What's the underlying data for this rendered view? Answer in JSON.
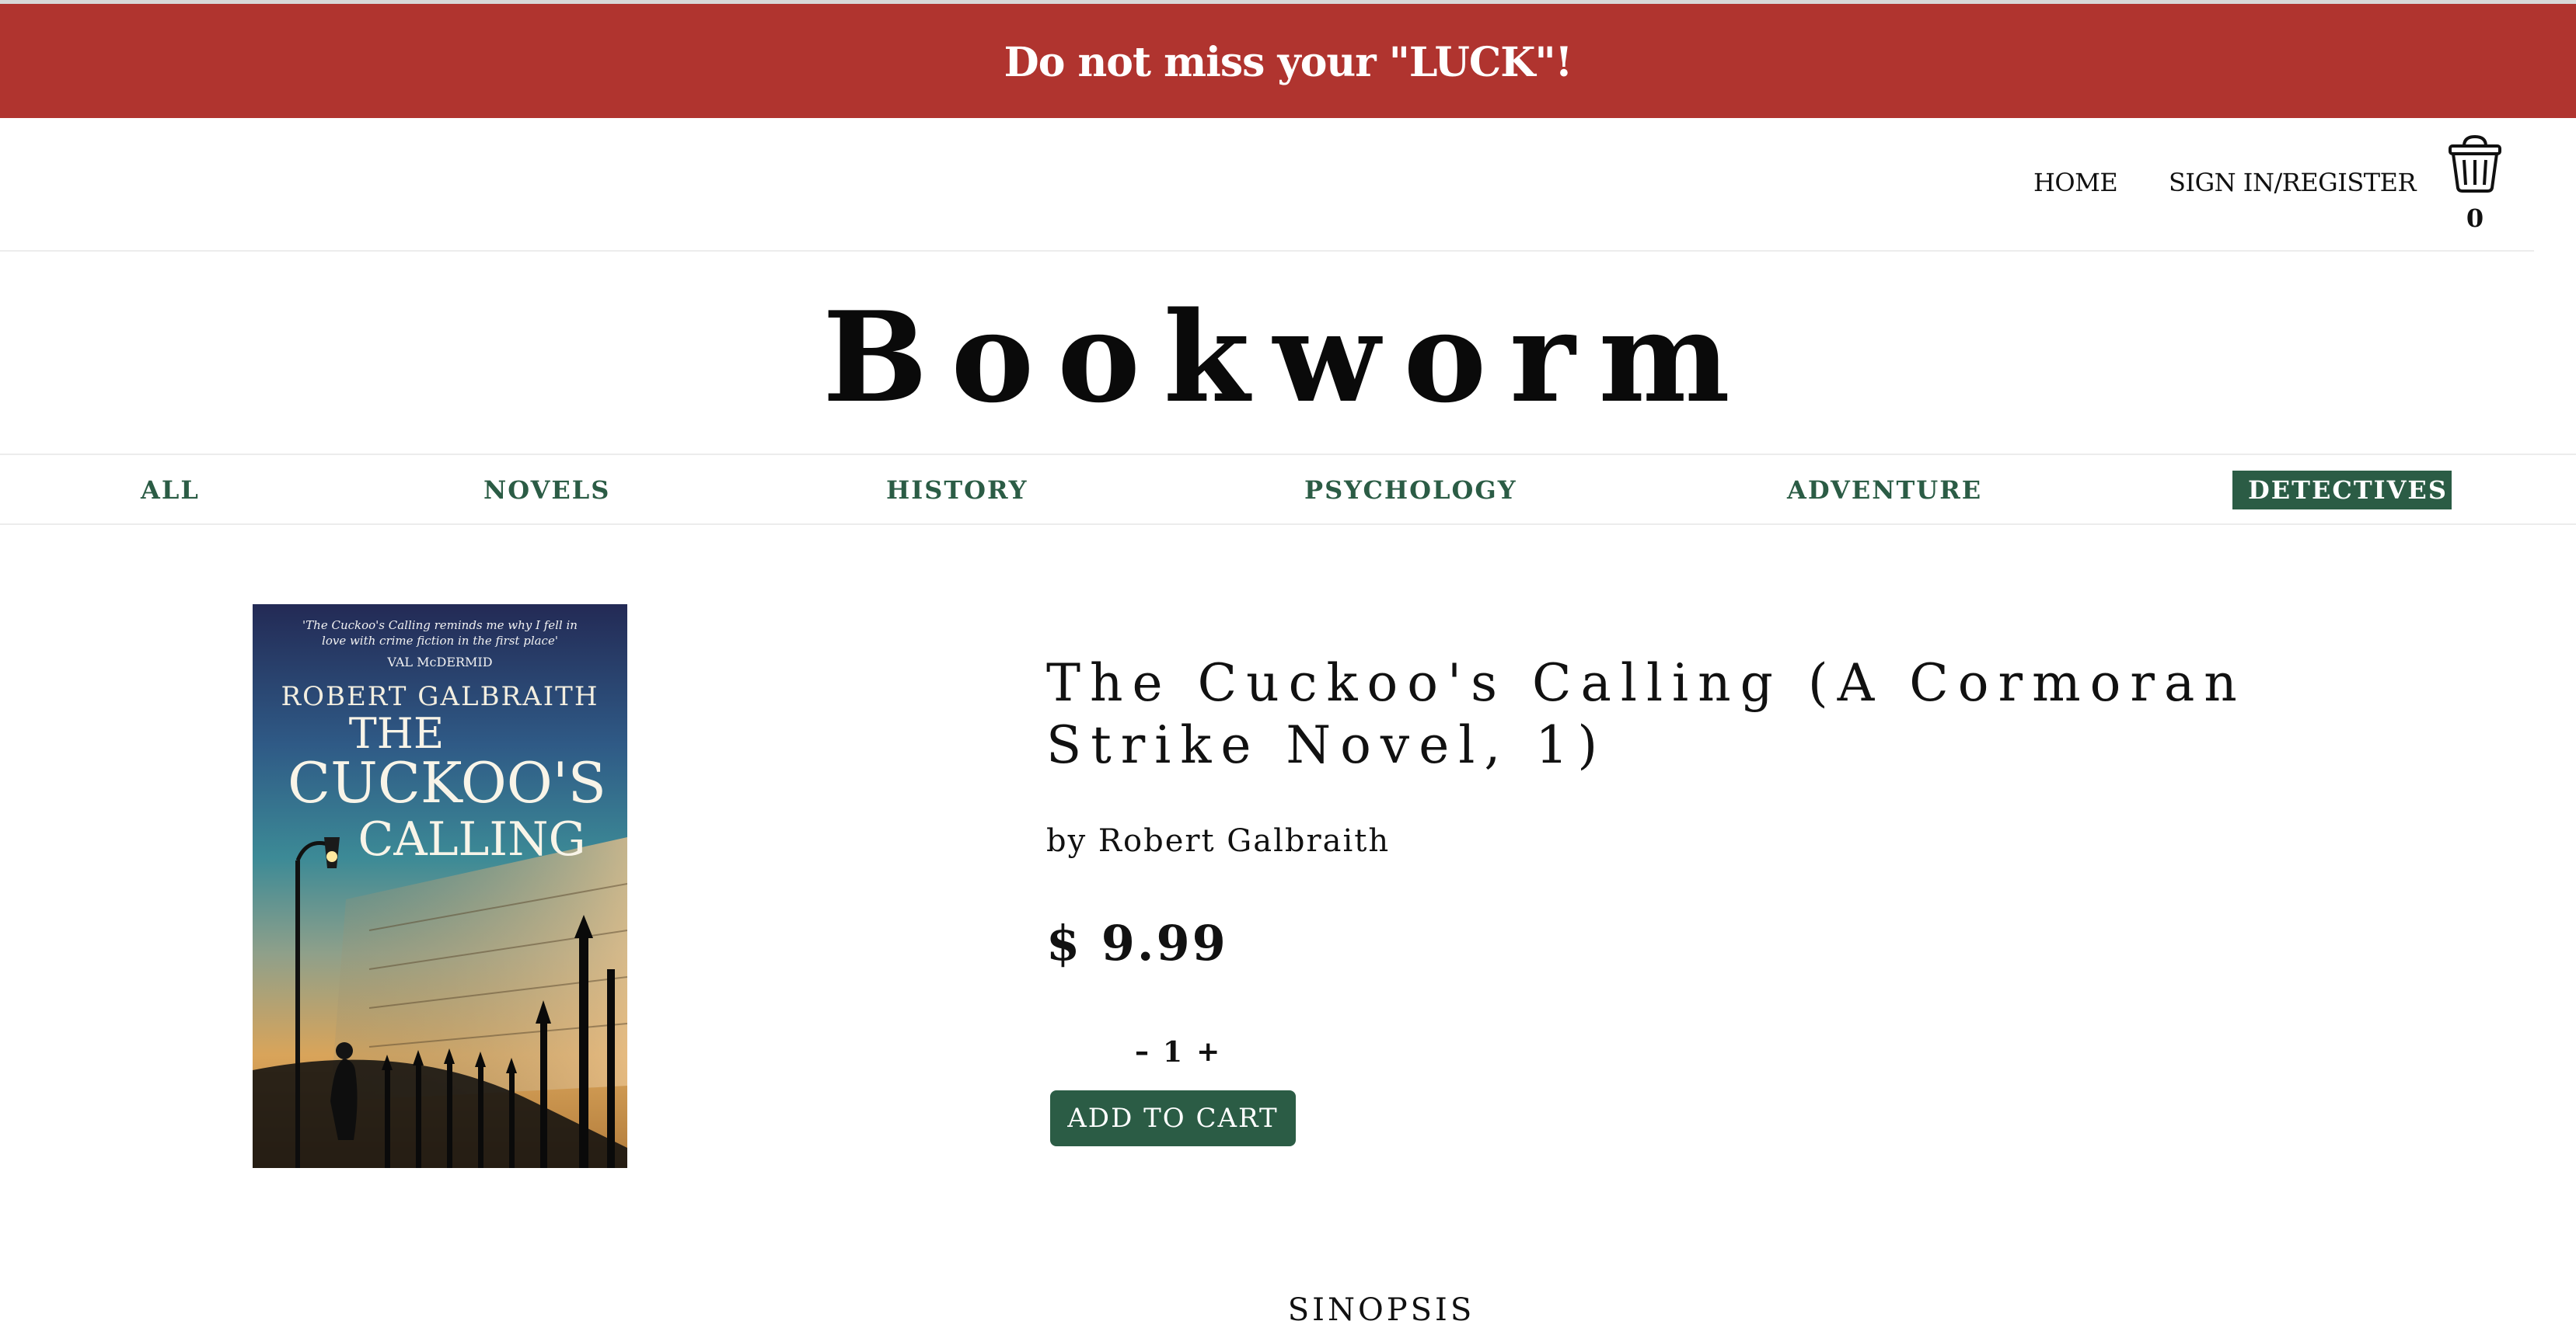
{
  "banner": {
    "text": "Do not miss your \"LUCK\"!"
  },
  "topnav": {
    "home": "HOME",
    "sign_in": "SIGN IN/REGISTER",
    "cart_count": "0"
  },
  "logo": "Bookworm",
  "categories": [
    {
      "label": "ALL",
      "active": false
    },
    {
      "label": "NOVELS",
      "active": false
    },
    {
      "label": "HISTORY",
      "active": false
    },
    {
      "label": "PSYCHOLOGY",
      "active": false
    },
    {
      "label": "ADVENTURE",
      "active": false
    },
    {
      "label": "DETECTIVES",
      "active": true
    }
  ],
  "product": {
    "title": "The Cuckoo's Calling (A Cormoran Strike Novel, 1)",
    "author": "by Robert Galbraith",
    "price": "$ 9.99",
    "quantity": "1",
    "add_to_cart": "ADD TO CART",
    "cover": {
      "quote": "'The Cuckoo's Calling reminds me why I fell in love with crime fiction in the first place'",
      "quote_author": "VAL McDERMID",
      "author": "ROBERT GALBRAITH",
      "title_line1": "THE",
      "title_line2": "CUCKOO'S",
      "title_line3": "CALLING"
    }
  },
  "section": {
    "sinopsis": "SINOPSIS"
  },
  "colors": {
    "banner": "#b0342f",
    "accent": "#2b5c45"
  }
}
